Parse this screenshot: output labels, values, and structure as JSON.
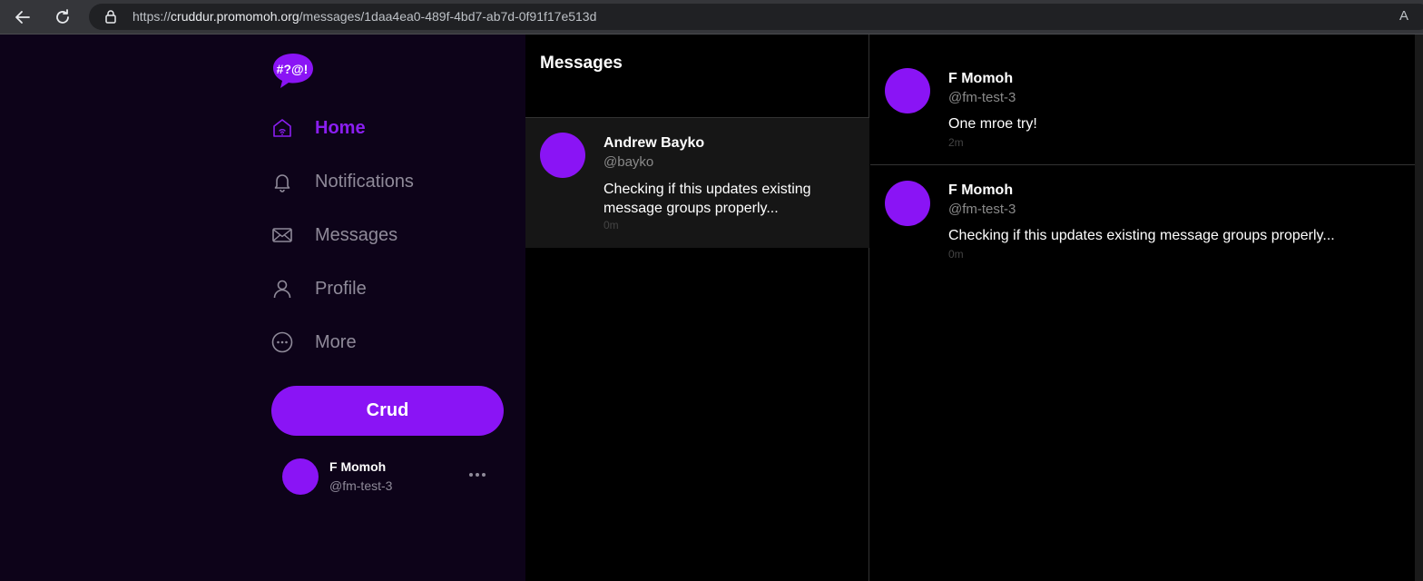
{
  "browser": {
    "url_scheme": "https://",
    "url_domain": "cruddur.promomoh.org",
    "url_path": "/messages/1daa4ea0-489f-4bd7-ab7d-0f91f17e513d",
    "right_glyph": "A"
  },
  "logo": {
    "text": "#?@!"
  },
  "sidebar": {
    "items": [
      {
        "label": "Home",
        "icon": "home-icon",
        "active": true
      },
      {
        "label": "Notifications",
        "icon": "bell-icon",
        "active": false
      },
      {
        "label": "Messages",
        "icon": "envelope-icon",
        "active": false
      },
      {
        "label": "Profile",
        "icon": "person-icon",
        "active": false
      },
      {
        "label": "More",
        "icon": "more-circle-icon",
        "active": false
      }
    ],
    "crud_label": "Crud",
    "current_user": {
      "name": "F Momoh",
      "handle": "@fm-test-3"
    }
  },
  "groups": {
    "title": "Messages",
    "items": [
      {
        "name": "Andrew Bayko",
        "handle": "@bayko",
        "message": "Checking if this updates existing message groups properly...",
        "time": "0m"
      }
    ]
  },
  "conversation": {
    "messages": [
      {
        "name": "F Momoh",
        "handle": "@fm-test-3",
        "message": "One mroe try!",
        "time": "2m"
      },
      {
        "name": "F Momoh",
        "handle": "@fm-test-3",
        "message": "Checking if this updates existing message groups properly...",
        "time": "0m"
      }
    ]
  },
  "colors": {
    "accent": "#8a14f5",
    "sidebar_bg": "#0d0319",
    "muted_text": "#8f8a99"
  }
}
